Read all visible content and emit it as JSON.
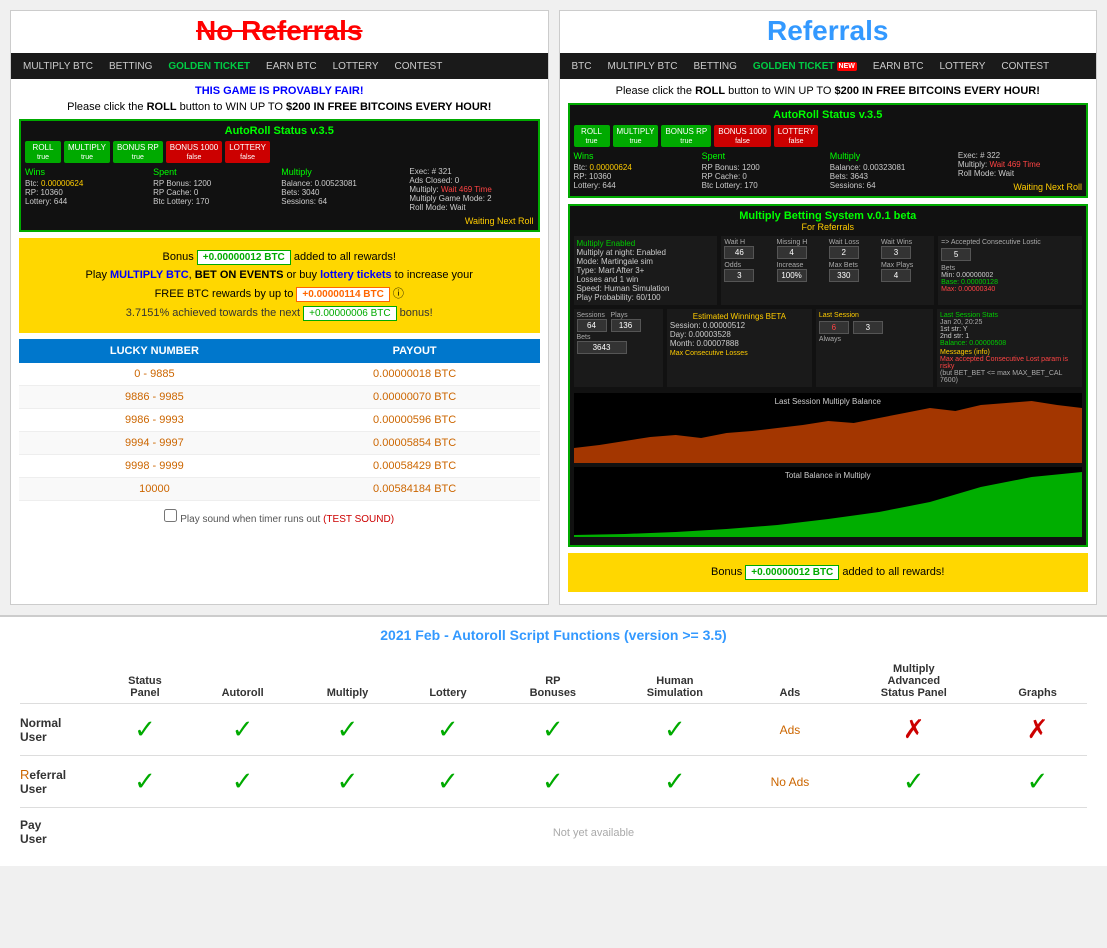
{
  "left_panel": {
    "title": "No Referrals",
    "nav": {
      "items": [
        "MULTIPLY BTC",
        "BETTING",
        "GOLDEN TICKET",
        "EARN BTC",
        "LOTTERY",
        "CONTEST"
      ],
      "active": "GOLDEN TICKET"
    },
    "fair_notice": "THIS GAME IS PROVABLY FAIR!",
    "win_notice": "Please click the ROLL button to WIN UP TO $200 IN FREE BITCOINS EVERY HOUR!",
    "autoroll": {
      "title": "AutoRoll Status v.3.5",
      "buttons": [
        {
          "label": "ROLL",
          "sub": "true",
          "color": "green"
        },
        {
          "label": "MULTIPLY",
          "sub": "true",
          "color": "green"
        },
        {
          "label": "BONUS RP",
          "sub": "true",
          "color": "green"
        },
        {
          "label": "BONUS 1000",
          "sub": "false",
          "color": "red"
        },
        {
          "label": "LOTTERY",
          "sub": "false",
          "color": "red"
        }
      ],
      "wins_title": "Wins",
      "spent_title": "Spent",
      "multiply_title": "Multiply",
      "exec_label": "Exec: # 321",
      "ads_closed": "Ads Closed: 0",
      "multiply_status": "Multiply: Wait 469 Time",
      "multiply_mode": "Multiply Game Mode: 2",
      "roll_mode": "Roll Mode: Wait",
      "btc_val": "Btc: 0.00000624",
      "rp_val": "RP: 10360",
      "lottery_val": "Lottery: 644",
      "rp_bonus": "RP Bonus: 1200",
      "rp_cache": "RP Cache: 0",
      "btc_lottery": "Btc Lottery: 170",
      "balance": "Balance: 0.00523081",
      "bets": "Bets: 3040",
      "sessions": "Sessions: 64",
      "waiting": "Waiting Next Roll"
    },
    "bonus": {
      "line1_pre": "Bonus:",
      "badge1": "+0.00000012 BTC",
      "line1_post": "added to all rewards!",
      "line2_pre": "Play",
      "link1": "MULTIPLY BTC",
      "line2_mid": ", BET ON EVENTS",
      "link2": "lottery tickets",
      "line2_post": "to increase your",
      "line3_pre": "FREE BTC rewards by up to",
      "badge2": "+0.00000114 BTC",
      "progress_pre": "3.7151% achieved towards the next",
      "badge3": "+0.00000006 BTC",
      "progress_post": "bonus!"
    },
    "table": {
      "col1": "LUCKY NUMBER",
      "col2": "PAYOUT",
      "rows": [
        {
          "range": "0 - 9885",
          "payout": "0.00000018 BTC"
        },
        {
          "range": "9886 - 9985",
          "payout": "0.00000070 BTC"
        },
        {
          "range": "9986 - 9993",
          "payout": "0.00000596 BTC"
        },
        {
          "range": "9994 - 9997",
          "payout": "0.00005854 BTC"
        },
        {
          "range": "9998 - 9999",
          "payout": "0.00058429 BTC"
        },
        {
          "range": "10000",
          "payout": "0.00584184 BTC"
        }
      ]
    },
    "sound_check": "Play sound when timer runs out",
    "test_sound": "(TEST SOUND)"
  },
  "right_panel": {
    "title": "Referrals",
    "nav": {
      "items": [
        "BTC",
        "MULTIPLY BTC",
        "BETTING",
        "GOLDEN TICKET",
        "EARN BTC",
        "LOTTERY",
        "CONTEST"
      ],
      "active": "GOLDEN TICKET",
      "golden_has_badge": true
    },
    "win_notice": "Please click the ROLL button to WIN UP TO $200 IN FREE BITCOINS EVERY HOUR!",
    "autoroll": {
      "title": "AutoRoll Status v.3.5",
      "buttons": [
        {
          "label": "ROLL",
          "sub": "true",
          "color": "green"
        },
        {
          "label": "MULTIPLY",
          "sub": "true",
          "color": "green"
        },
        {
          "label": "BONUS RP",
          "sub": "true",
          "color": "green"
        },
        {
          "label": "BONUS 1000",
          "sub": "false",
          "color": "red"
        },
        {
          "label": "LOTTERY",
          "sub": "false",
          "color": "red"
        }
      ],
      "exec_label": "Exec: # 322",
      "multiply_status": "Multiply: Wait 469 Time",
      "roll_mode": "Roll Mode: Wait"
    },
    "multiply_betting": {
      "title": "Multiply Betting System v.0.1 beta",
      "subtitle": "For Referrals",
      "enabled": "Multiply Enabled",
      "night": "Multiply at night: Enabled",
      "mode": "Mode: Martingale sim",
      "type": "Type: Mart After 3+",
      "losses": "Losses and 1 win",
      "speed": "Speed: Human Simulation",
      "probability": "Play Probability: 60/100",
      "wait_h": "Wait H",
      "wait_h_val": "46",
      "missing_h": "Missing H",
      "missing_h_val": "4",
      "wait_loss": "Wait Loss",
      "wait_loss_val": "2",
      "wait_wins": "Wait Wins",
      "wait_wins_val": "3",
      "odds": "Odds",
      "increase": "Increase",
      "increase_val": "100%",
      "max_bets": "Max Bets",
      "max_bets_val": "330",
      "max_plays": "Max Plays",
      "max_plays_val": "4",
      "accepted_label": "=> Accepted Consecutive Lostic",
      "accepted_val": "5",
      "bets_min": "Min: 0.00000002",
      "bets_base": "Base: 0.00000128",
      "bets_max": "Max: 0.00000340",
      "sessions": "Sessions",
      "sessions_val": "64",
      "plays": "Plays",
      "plays_val": "136",
      "bets": "Bets",
      "bets_val": "3643",
      "estimated": "Estimated Winnings BETA",
      "session_est": "Session: 0.00000512",
      "day_est": "Day: 0.00003528",
      "month_est": "Month: 0.00007888",
      "max_consec_title": "Max Consecutive Losses",
      "max_consec_last": "Last Session",
      "consec_val1": "6",
      "consec_val2": "3",
      "last_session_title": "Last Session Stats",
      "last_date": "Jan 20, 20:25",
      "str1": "1st str: Y",
      "str2": "2nd str: 1",
      "balance_last": "Balance: 0.00000508",
      "messages_title": "Messages (info)",
      "messages_warning": "Max accepted Consecutive Lost param is risky",
      "messages_detail": "(but BET_BET <= max MAX_BET_CAL 7600)",
      "always": "Always"
    },
    "graph1_label": "Last Session Multiply Balance",
    "graph2_label": "Total Balance in Multiply",
    "bonus": {
      "badge1": "+0.00000012 BTC",
      "line1_post": "added to all rewards!"
    }
  },
  "comparison": {
    "title": "2021 Feb - Autoroll Script Functions (version >= 3.5)",
    "columns": [
      "Status Panel",
      "Autoroll",
      "Multiply",
      "Lottery",
      "RP Bonuses",
      "Human Simulation",
      "Ads",
      "Multiply Advanced Status Panel",
      "Graphs"
    ],
    "rows": [
      {
        "label": "Normal User",
        "values": [
          "check",
          "check",
          "check",
          "check",
          "check",
          "check",
          "ads",
          "cross",
          "cross"
        ]
      },
      {
        "label": "Referral User",
        "values": [
          "check",
          "check",
          "check",
          "check",
          "check",
          "check",
          "no-ads",
          "check",
          "check"
        ]
      },
      {
        "label": "Pay User",
        "values": [
          "na",
          "na",
          "na",
          "na",
          "na",
          "na",
          "na",
          "na",
          "na"
        ],
        "special": "Not yet available"
      }
    ],
    "ads_text": "Ads",
    "no_ads_text": "No Ads",
    "not_available": "Not yet available"
  }
}
